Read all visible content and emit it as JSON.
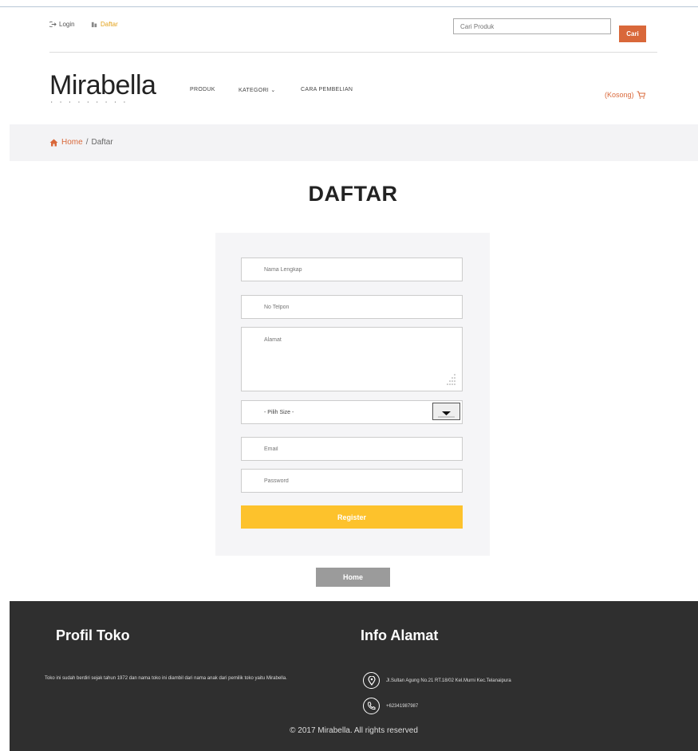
{
  "topbar": {
    "login_label": "Login",
    "daftar_label": "Daftar",
    "search_placeholder": "Cari Produk",
    "search_button": "Cari"
  },
  "brand": {
    "name": "Mirabella"
  },
  "nav": {
    "items": [
      "PRODUK",
      "KATEGORI",
      "CARA PEMBELIAN"
    ]
  },
  "cart": {
    "label": "(Kosong)"
  },
  "breadcrumb": {
    "home": "Home",
    "separator": "/",
    "current": "Daftar"
  },
  "page": {
    "title": "DAFTAR"
  },
  "form": {
    "name_placeholder": "Nama Lengkap",
    "phone_placeholder": "No Telpon",
    "address_placeholder": "Alamat",
    "size_selected": "- Pilih Size -",
    "email_placeholder": "Email",
    "password_placeholder": "Password",
    "register_label": "Register"
  },
  "home_button": "Home",
  "footer": {
    "profile_title": "Profil Toko",
    "profile_text": "Toko ini sudah berdiri sejak tahun 1972 dan nama toko ini diambil dari nama anak dari pemilik toko yaitu Mirabella.",
    "address_title": "Info Alamat",
    "address_text": "Jl.Sultan Agung No.21 RT.18/02 Kel.Murni Kec.Telanaipura",
    "phone_text": "+62341987987",
    "copyright": "© 2017 Mirabella. All rights reserved"
  },
  "colors": {
    "accent": "#d9683a",
    "register": "#fdc22c",
    "footer_bg": "#2f2f2f",
    "daftar_link": "#e3a21a"
  }
}
